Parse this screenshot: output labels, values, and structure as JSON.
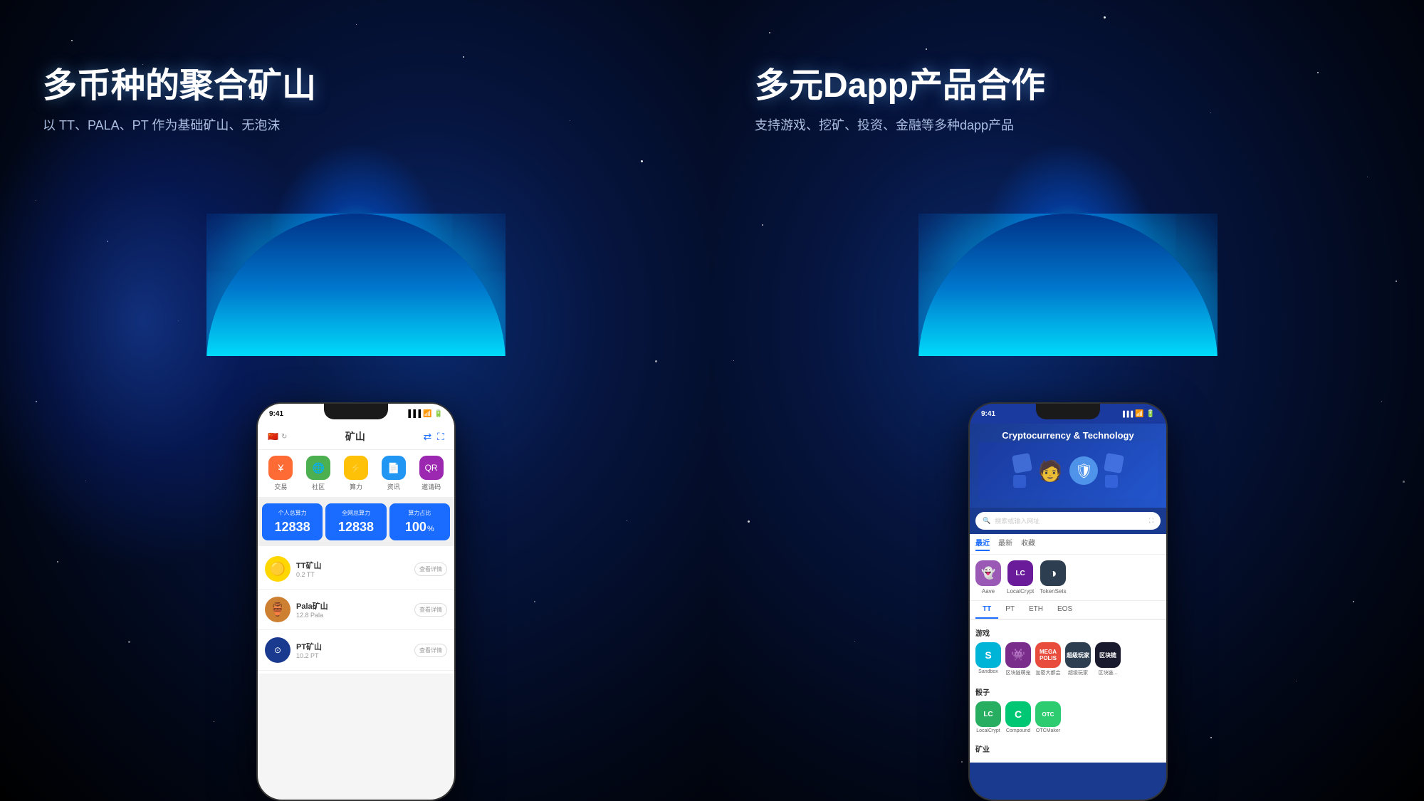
{
  "left_panel": {
    "main_title": "多币种的聚合矿山",
    "sub_title": "以 TT、PALA、PT 作为基础矿山、无泡沫",
    "phone": {
      "time": "9:41",
      "nav_title": "矿山",
      "icons": [
        {
          "label": "交易",
          "emoji": "¥",
          "bg": "#ff6b35"
        },
        {
          "label": "社区",
          "emoji": "🌐",
          "bg": "#4caf50"
        },
        {
          "label": "算力",
          "emoji": "⚡",
          "bg": "#ffc107"
        },
        {
          "label": "资讯",
          "emoji": "📄",
          "bg": "#2196f3"
        },
        {
          "label": "邀请码",
          "emoji": "📷",
          "bg": "#9c27b0"
        }
      ],
      "stats": [
        {
          "label": "个人总算力",
          "value": "12838"
        },
        {
          "label": "全网总算力",
          "value": "12838"
        },
        {
          "label": "算力占比",
          "value": "100",
          "unit": "%"
        }
      ],
      "mines": [
        {
          "name": "TT矿山",
          "amount": "0.2 TT",
          "emoji": "🟡",
          "bg": "#ffd700"
        },
        {
          "name": "Pala矿山",
          "amount": "12.8 Pala",
          "emoji": "🟠",
          "bg": "#cd7f32"
        },
        {
          "name": "PT矿山",
          "amount": "10.2 PT",
          "emoji": "🔵",
          "bg": "#1a6bff"
        }
      ],
      "btn_label": "查看详情"
    }
  },
  "right_panel": {
    "main_title": "多元Dapp产品合作",
    "sub_title": "支持游戏、挖矿、投资、金融等多种dapp产品",
    "phone": {
      "time": "9:41",
      "dapp_title": "Cryptocurrency &\nTechnology",
      "search_placeholder": "搜索或输入网址",
      "tabs": [
        "最近",
        "最新",
        "收藏"
      ],
      "active_tab": "最近",
      "recent_apps": [
        {
          "label": "Aave",
          "emoji": "👻",
          "bg": "#9b59b6"
        },
        {
          "label": "LocalCrypt",
          "emoji": "LC",
          "bg": "#8e44ad"
        },
        {
          "label": "TokenSets",
          "emoji": "◐",
          "bg": "#2c3e50"
        }
      ],
      "category_tabs": [
        "TT",
        "PT",
        "ETH",
        "EOS"
      ],
      "active_cat": "TT",
      "sections": [
        {
          "label": "游戏",
          "apps": [
            {
              "label": "Sandbox",
              "emoji": "S",
              "bg": "#00b4d8"
            },
            {
              "label": "区块链萌宠",
              "emoji": "👾",
              "bg": "#7b2d8b"
            },
            {
              "label": "加密大都会",
              "emoji": "MP",
              "bg": "#e74c3c"
            },
            {
              "label": "超级玩家",
              "emoji": "SP",
              "bg": "#2c3e50"
            },
            {
              "label": "区块链...",
              "emoji": "B",
              "bg": "#1a1a1a"
            }
          ]
        },
        {
          "label": "骰子",
          "apps": [
            {
              "label": "LocalCrypt",
              "emoji": "LC",
              "bg": "#27ae60"
            },
            {
              "label": "Compound",
              "emoji": "C",
              "bg": "#00c774"
            },
            {
              "label": "OTCMaker",
              "emoji": "OTC",
              "bg": "#2ecc71"
            }
          ]
        },
        {
          "label": "矿业",
          "apps": []
        }
      ]
    }
  }
}
